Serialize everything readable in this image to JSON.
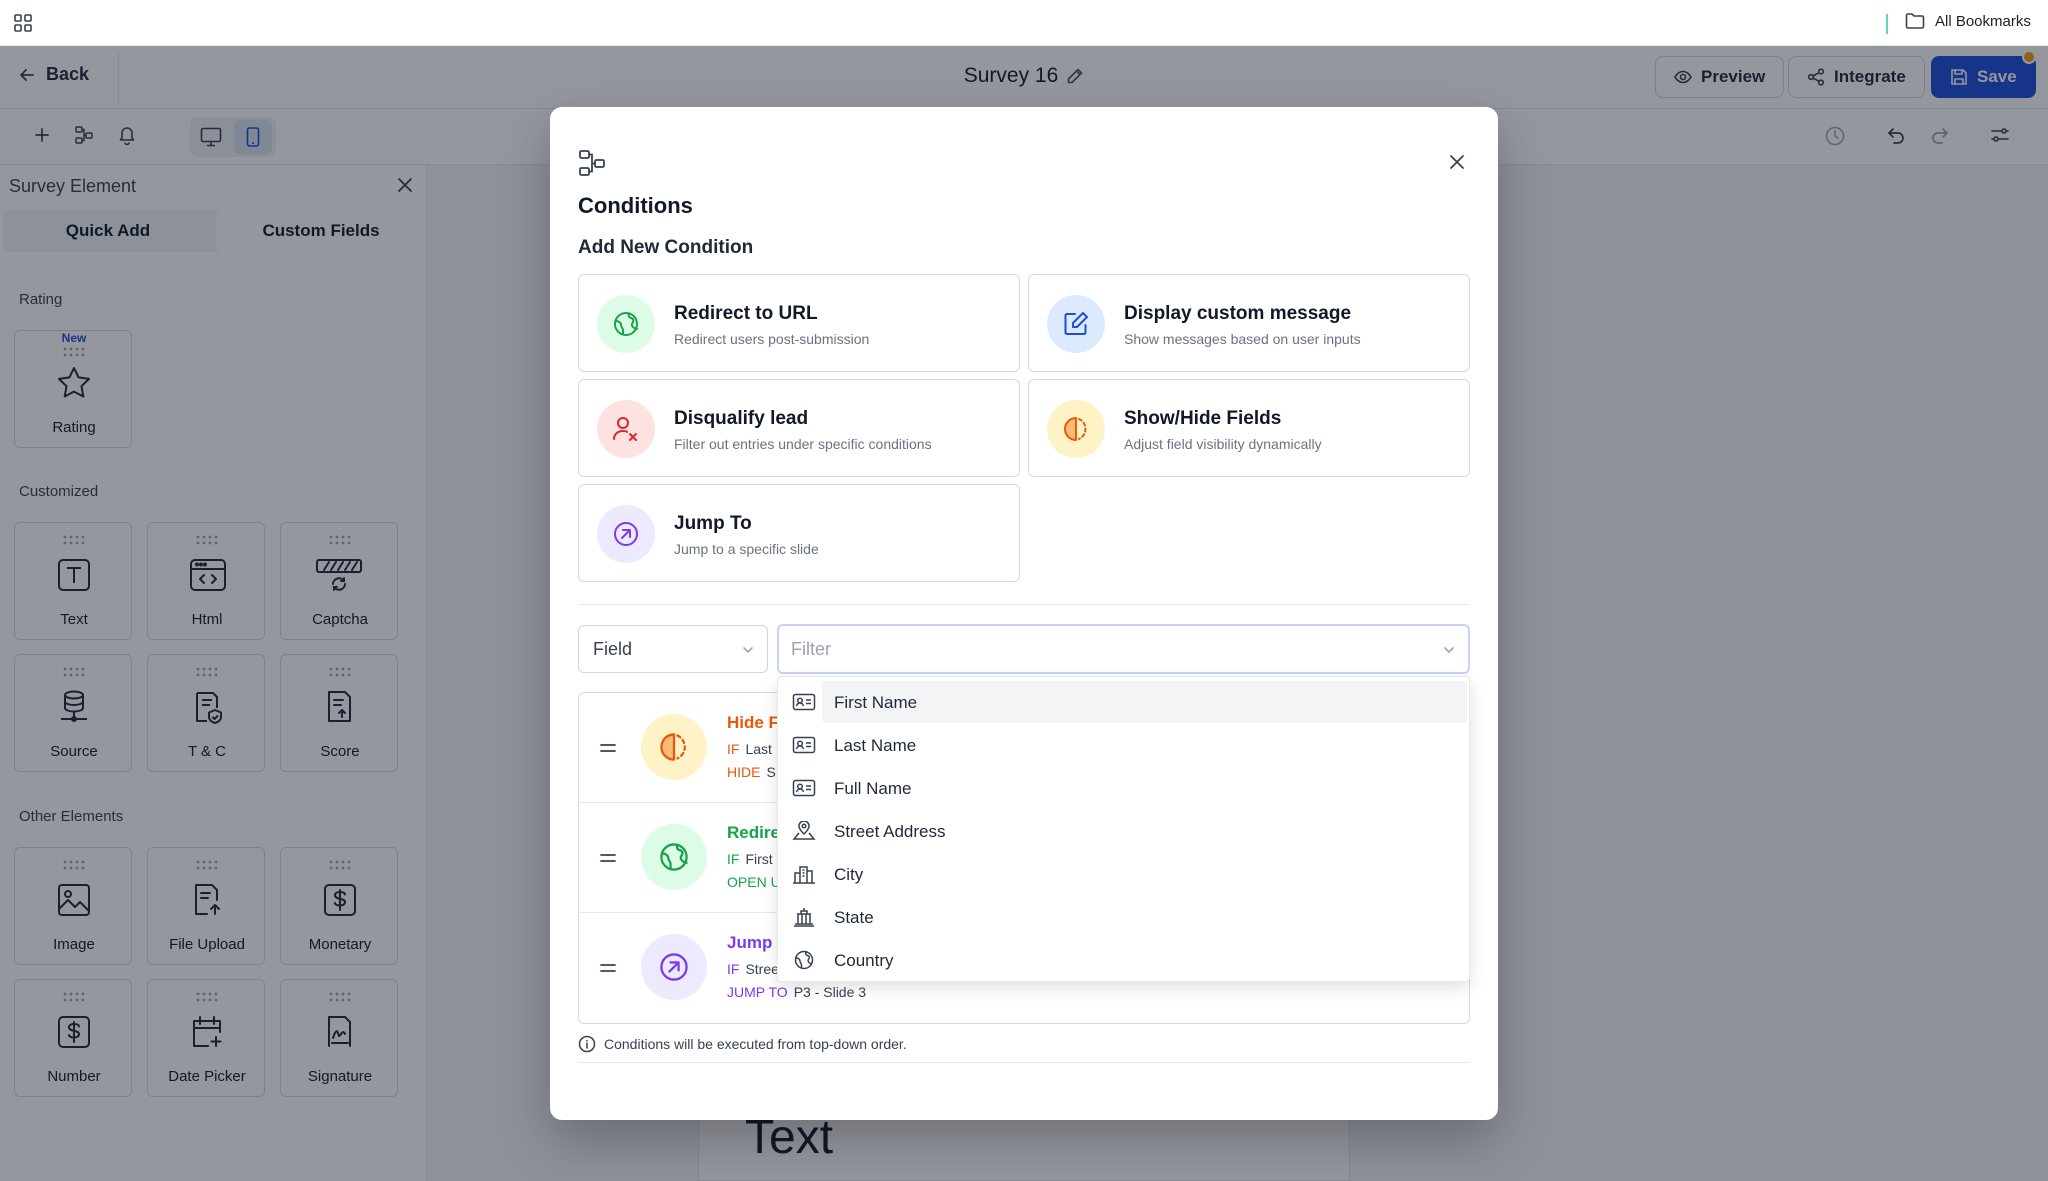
{
  "bookmarks": {
    "label": "All Bookmarks"
  },
  "header": {
    "back_label": "Back",
    "survey_title": "Survey 16",
    "preview_label": "Preview",
    "integrate_label": "Integrate",
    "save_label": "Save"
  },
  "panel": {
    "title": "Survey Element",
    "tabs": [
      "Quick Add",
      "Custom Fields"
    ],
    "sections": {
      "rating": "Rating",
      "customized": "Customized",
      "other": "Other Elements"
    },
    "new_badge": "New",
    "tiles": {
      "rating": "Rating",
      "text": "Text",
      "html": "Html",
      "captcha": "Captcha",
      "source": "Source",
      "tc": "T & C",
      "score": "Score",
      "image": "Image",
      "file_upload": "File Upload",
      "monetary": "Monetary",
      "number": "Number",
      "date_picker": "Date Picker",
      "signature": "Signature"
    }
  },
  "canvas": {
    "text": "Text"
  },
  "modal": {
    "title": "Conditions",
    "subtitle": "Add New Condition",
    "cards": [
      {
        "title": "Redirect to URL",
        "desc": "Redirect users post-submission"
      },
      {
        "title": "Display custom message",
        "desc": "Show messages based on user inputs"
      },
      {
        "title": "Disqualify lead",
        "desc": "Filter out entries under specific conditions"
      },
      {
        "title": "Show/Hide Fields",
        "desc": "Adjust field visibility dynamically"
      },
      {
        "title": "Jump To",
        "desc": "Jump to a specific slide"
      }
    ],
    "field_select": "Field",
    "filter_placeholder": "Filter",
    "conditions": [
      {
        "title": "Hide F",
        "kw1": "IF",
        "v1": "Last I",
        "kw2": "HIDE",
        "v2": "S"
      },
      {
        "title": "Redire",
        "kw1": "IF",
        "v1": "First",
        "kw2": "OPEN U",
        "v2": ""
      },
      {
        "title": "Jump T",
        "kw1": "IF",
        "v1": "Stree",
        "kw2": "JUMP TO",
        "v2": "P3 - Slide 3"
      }
    ],
    "footnote": "Conditions will be executed from top-down order.",
    "dropdown": [
      {
        "label": "First Name",
        "icon": "id-card-icon"
      },
      {
        "label": "Last Name",
        "icon": "id-card-icon"
      },
      {
        "label": "Full Name",
        "icon": "id-card-icon"
      },
      {
        "label": "Street Address",
        "icon": "map-pin-icon"
      },
      {
        "label": "City",
        "icon": "city-icon"
      },
      {
        "label": "State",
        "icon": "building-columns-icon"
      },
      {
        "label": "Country",
        "icon": "globe-icon"
      }
    ]
  },
  "colors": {
    "primary": "#1d4ed8",
    "orange": "#ea580c",
    "green": "#16a34a",
    "purple": "#7c3aed",
    "red": "#dc2626"
  }
}
